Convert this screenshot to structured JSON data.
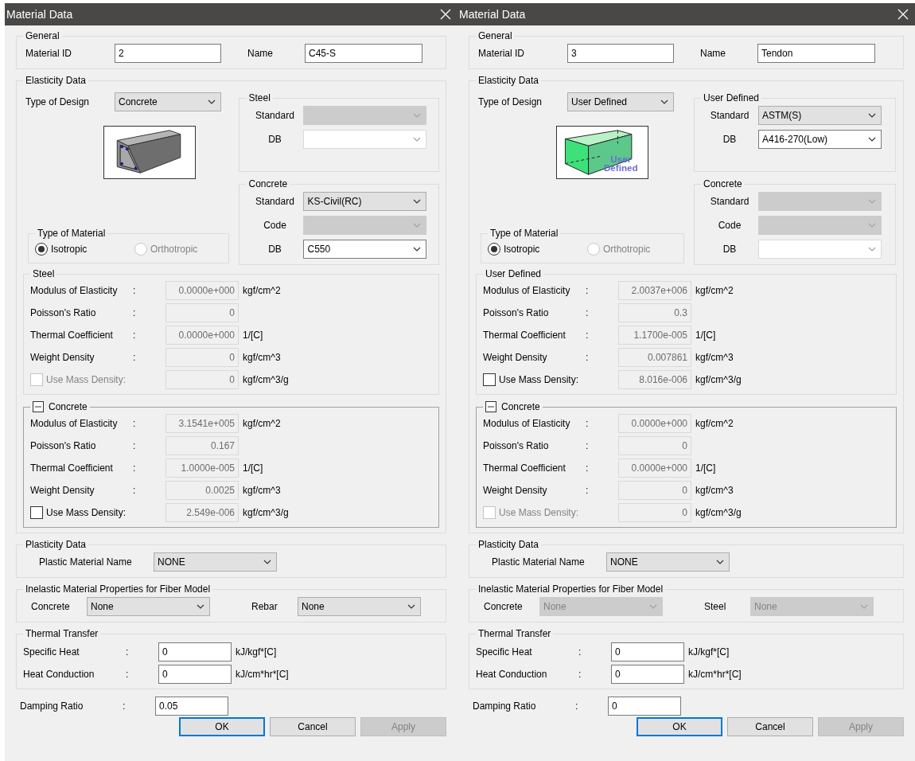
{
  "dialogs": [
    {
      "title": "Material Data",
      "general": {
        "title": "General",
        "id_label": "Material ID",
        "id_value": "2",
        "name_label": "Name",
        "name_value": "C45-S"
      },
      "elasticity": {
        "title": "Elasticity Data",
        "design_label": "Type of Design",
        "design_value": "Concrete",
        "picture": {
          "kind": "concrete"
        },
        "material": {
          "title": "Type of Material",
          "options": [
            {
              "label": "Isotropic",
              "selected": true,
              "disabled": false
            },
            {
              "label": "Orthotropic",
              "selected": false,
              "disabled": true
            }
          ]
        },
        "standards": [
          {
            "title": "Steel",
            "rows": [
              {
                "label": "Standard",
                "kind": "list",
                "disabled": true
              },
              {
                "label": "DB",
                "kind": "combo",
                "disabled": true
              }
            ]
          },
          {
            "title": "Concrete",
            "rows": [
              {
                "label": "Standard",
                "kind": "list",
                "value": "KS-Civil(RC)",
                "disabled": false
              },
              {
                "label": "Code",
                "kind": "list",
                "disabled": true
              },
              {
                "label": "DB",
                "kind": "combo",
                "value": "C550",
                "disabled": false
              }
            ]
          }
        ],
        "property_groups": [
          {
            "title": "Steel",
            "collapsible": false,
            "rows": [
              {
                "kind": "field",
                "label": "Modulus of Elasticity",
                "sep": ":",
                "value": "0.0000e+000",
                "unit": "kgf/cm^2"
              },
              {
                "kind": "field",
                "label": "Poisson's Ratio",
                "sep": ":",
                "value": "0"
              },
              {
                "kind": "field",
                "label": "Thermal Coefficient",
                "sep": ":",
                "value": "0.0000e+000",
                "unit": "1/[C]"
              },
              {
                "kind": "field",
                "label": "Weight Density",
                "sep": ":",
                "value": "0",
                "unit": "kgf/cm^3"
              },
              {
                "kind": "check",
                "label": "Use Mass Density:",
                "checked": false,
                "disabled": true,
                "value": "0",
                "unit": "kgf/cm^3/g"
              }
            ]
          },
          {
            "title": "Concrete",
            "collapsible": true,
            "rows": [
              {
                "kind": "field",
                "label": "Modulus of Elasticity",
                "sep": ":",
                "value": "3.1541e+005",
                "unit": "kgf/cm^2"
              },
              {
                "kind": "field",
                "label": "Poisson's Ratio",
                "sep": ":",
                "value": "0.167"
              },
              {
                "kind": "field",
                "label": "Thermal Coefficient",
                "sep": ":",
                "value": "1.0000e-005",
                "unit": "1/[C]"
              },
              {
                "kind": "field",
                "label": "Weight Density",
                "sep": ":",
                "value": "0.0025",
                "unit": "kgf/cm^3"
              },
              {
                "kind": "check",
                "label": "Use Mass Density:",
                "checked": false,
                "disabled": false,
                "value": "2.549e-006",
                "unit": "kgf/cm^3/g"
              }
            ]
          }
        ]
      },
      "plasticity": {
        "title": "Plasticity Data",
        "label": "Plastic Material Name",
        "value": "NONE"
      },
      "inelastic": {
        "title": "Inelastic Material Properties for Fiber Model",
        "items": [
          {
            "label": "Concrete",
            "value": "None",
            "disabled": false
          },
          {
            "label": "Rebar",
            "value": "None",
            "disabled": false
          }
        ]
      },
      "thermal": {
        "title": "Thermal Transfer",
        "rows": [
          {
            "label": "Specific Heat",
            "sep": ":",
            "value": "0",
            "unit": "kJ/kgf*[C]"
          },
          {
            "label": "Heat Conduction",
            "sep": ":",
            "value": "0",
            "unit": "kJ/cm*hr*[C]"
          }
        ]
      },
      "damping": {
        "label": "Damping Ratio",
        "sep": ":",
        "value": "0.05"
      },
      "buttons": [
        {
          "label": "OK",
          "default": true,
          "disabled": false
        },
        {
          "label": "Cancel",
          "default": false,
          "disabled": false
        },
        {
          "label": "Apply",
          "default": false,
          "disabled": true
        }
      ]
    },
    {
      "title": "Material Data",
      "general": {
        "title": "General",
        "id_label": "Material ID",
        "id_value": "3",
        "name_label": "Name",
        "name_value": "Tendon"
      },
      "elasticity": {
        "title": "Elasticity Data",
        "design_label": "Type of Design",
        "design_value": "User Defined",
        "picture": {
          "kind": "user_defined",
          "caption": [
            "User",
            "Defined"
          ]
        },
        "material": {
          "title": "Type of Material",
          "options": [
            {
              "label": "Isotropic",
              "selected": true,
              "disabled": false
            },
            {
              "label": "Orthotropic",
              "selected": false,
              "disabled": true
            }
          ]
        },
        "standards": [
          {
            "title": "User Defined",
            "rows": [
              {
                "label": "Standard",
                "kind": "list",
                "value": "ASTM(S)",
                "disabled": false
              },
              {
                "label": "DB",
                "kind": "combo",
                "value": "A416-270(Low)",
                "disabled": false
              }
            ]
          },
          {
            "title": "Concrete",
            "rows": [
              {
                "label": "Standard",
                "kind": "list",
                "disabled": true
              },
              {
                "label": "Code",
                "kind": "list",
                "disabled": true
              },
              {
                "label": "DB",
                "kind": "combo",
                "disabled": true
              }
            ]
          }
        ],
        "property_groups": [
          {
            "title": "User Defined",
            "collapsible": false,
            "rows": [
              {
                "kind": "field",
                "label": "Modulus of Elasticity",
                "sep": ":",
                "value": "2.0037e+006",
                "unit": "kgf/cm^2"
              },
              {
                "kind": "field",
                "label": "Poisson's Ratio",
                "sep": ":",
                "value": "0.3"
              },
              {
                "kind": "field",
                "label": "Thermal Coefficient",
                "sep": ":",
                "value": "1.1700e-005",
                "unit": "1/[C]"
              },
              {
                "kind": "field",
                "label": "Weight Density",
                "sep": ":",
                "value": "0.007861",
                "unit": "kgf/cm^3"
              },
              {
                "kind": "check",
                "label": "Use Mass Density:",
                "checked": false,
                "disabled": false,
                "value": "8.016e-006",
                "unit": "kgf/cm^3/g"
              }
            ]
          },
          {
            "title": "Concrete",
            "collapsible": true,
            "rows": [
              {
                "kind": "field",
                "label": "Modulus of Elasticity",
                "sep": ":",
                "value": "0.0000e+000",
                "unit": "kgf/cm^2"
              },
              {
                "kind": "field",
                "label": "Poisson's Ratio",
                "sep": ":",
                "value": "0"
              },
              {
                "kind": "field",
                "label": "Thermal Coefficient",
                "sep": ":",
                "value": "0.0000e+000",
                "unit": "1/[C]"
              },
              {
                "kind": "field",
                "label": "Weight Density",
                "sep": ":",
                "value": "0",
                "unit": "kgf/cm^3"
              },
              {
                "kind": "check",
                "label": "Use Mass Density:",
                "checked": false,
                "disabled": true,
                "value": "0",
                "unit": "kgf/cm^3/g"
              }
            ]
          }
        ]
      },
      "plasticity": {
        "title": "Plasticity Data",
        "label": "Plastic Material Name",
        "value": "NONE"
      },
      "inelastic": {
        "title": "Inelastic Material Properties for Fiber Model",
        "items": [
          {
            "label": "Concrete",
            "value": "None",
            "disabled": true
          },
          {
            "label": "Steel",
            "value": "None",
            "disabled": true
          }
        ]
      },
      "thermal": {
        "title": "Thermal Transfer",
        "rows": [
          {
            "label": "Specific Heat",
            "sep": ":",
            "value": "0",
            "unit": "kJ/kgf*[C]"
          },
          {
            "label": "Heat Conduction",
            "sep": ":",
            "value": "0",
            "unit": "kJ/cm*hr*[C]"
          }
        ]
      },
      "damping": {
        "label": "Damping Ratio",
        "sep": ":",
        "value": "0"
      },
      "buttons": [
        {
          "label": "OK",
          "default": true,
          "disabled": false
        },
        {
          "label": "Cancel",
          "default": false,
          "disabled": false
        },
        {
          "label": "Apply",
          "default": false,
          "disabled": true
        }
      ]
    }
  ]
}
